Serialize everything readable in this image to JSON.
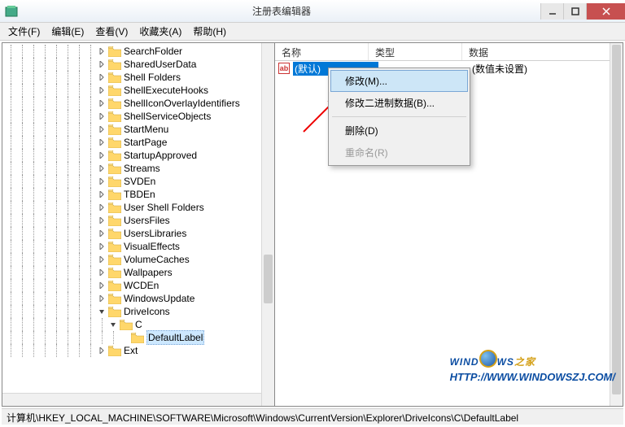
{
  "window": {
    "title": "注册表编辑器"
  },
  "menu": {
    "file": "文件(F)",
    "edit": "编辑(E)",
    "view": "查看(V)",
    "favorites": "收藏夹(A)",
    "help": "帮助(H)"
  },
  "tree": {
    "nodes": [
      {
        "depth": 8,
        "expander": "right",
        "label": "SearchFolder"
      },
      {
        "depth": 8,
        "expander": "right",
        "label": "SharedUserData"
      },
      {
        "depth": 8,
        "expander": "right",
        "label": "Shell Folders"
      },
      {
        "depth": 8,
        "expander": "right",
        "label": "ShellExecuteHooks"
      },
      {
        "depth": 8,
        "expander": "right",
        "label": "ShellIconOverlayIdentifiers"
      },
      {
        "depth": 8,
        "expander": "right",
        "label": "ShellServiceObjects"
      },
      {
        "depth": 8,
        "expander": "right",
        "label": "StartMenu"
      },
      {
        "depth": 8,
        "expander": "right",
        "label": "StartPage"
      },
      {
        "depth": 8,
        "expander": "right",
        "label": "StartupApproved"
      },
      {
        "depth": 8,
        "expander": "right",
        "label": "Streams"
      },
      {
        "depth": 8,
        "expander": "right",
        "label": "SVDEn"
      },
      {
        "depth": 8,
        "expander": "right",
        "label": "TBDEn"
      },
      {
        "depth": 8,
        "expander": "right",
        "label": "User Shell Folders"
      },
      {
        "depth": 8,
        "expander": "right",
        "label": "UsersFiles"
      },
      {
        "depth": 8,
        "expander": "right",
        "label": "UsersLibraries"
      },
      {
        "depth": 8,
        "expander": "right",
        "label": "VisualEffects"
      },
      {
        "depth": 8,
        "expander": "right",
        "label": "VolumeCaches"
      },
      {
        "depth": 8,
        "expander": "right",
        "label": "Wallpapers"
      },
      {
        "depth": 8,
        "expander": "right",
        "label": "WCDEn"
      },
      {
        "depth": 8,
        "expander": "right",
        "label": "WindowsUpdate"
      },
      {
        "depth": 8,
        "expander": "down",
        "label": "DriveIcons"
      },
      {
        "depth": 9,
        "expander": "down",
        "label": "C"
      },
      {
        "depth": 10,
        "expander": "none",
        "label": "DefaultLabel",
        "selected": true
      },
      {
        "depth": 8,
        "expander": "right",
        "label": "Ext"
      }
    ]
  },
  "list": {
    "columns": {
      "name": "名称",
      "type": "类型",
      "data": "数据"
    },
    "rows": [
      {
        "name": "(默认)",
        "type": "",
        "data": "(数值未设置)",
        "selected": true
      }
    ]
  },
  "context_menu": {
    "modify": "修改(M)...",
    "modify_binary": "修改二进制数据(B)...",
    "delete": "删除(D)",
    "rename": "重命名(R)"
  },
  "statusbar": {
    "path": "计算机\\HKEY_LOCAL_MACHINE\\SOFTWARE\\Microsoft\\Windows\\CurrentVersion\\Explorer\\DriveIcons\\C\\DefaultLabel"
  },
  "watermark": {
    "text_wind": "WIND",
    "text_ws": "WS",
    "text_zj": "之家",
    "url": "HTTP://WWW.WINDOWSZJ.COM/"
  }
}
